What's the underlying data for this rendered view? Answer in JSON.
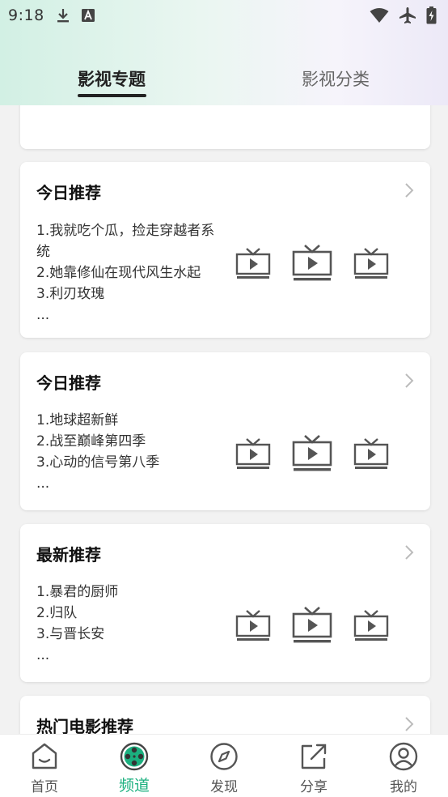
{
  "status": {
    "time": "9:18"
  },
  "tabs": [
    {
      "label": "影视专题",
      "active": true
    },
    {
      "label": "影视分类",
      "active": false
    }
  ],
  "cards": [
    {
      "title": "今日推荐",
      "lines": [
        "1.我就吃个瓜，捡走穿越者系统",
        "2.她靠修仙在现代风生水起",
        "3.利刃玫瑰",
        "..."
      ]
    },
    {
      "title": "今日推荐",
      "lines": [
        "1.地球超新鲜",
        "2.战至巅峰第四季",
        "3.心动的信号第八季",
        "..."
      ]
    },
    {
      "title": "最新推荐",
      "lines": [
        "1.暴君的厨师",
        "2.归队",
        "3.与晋长安",
        "..."
      ]
    },
    {
      "title": "热门电影推荐",
      "lines": []
    }
  ],
  "bottom_nav": [
    {
      "label": "首页",
      "icon": "home-face-icon",
      "active": false
    },
    {
      "label": "频道",
      "icon": "film-reel-icon",
      "active": true
    },
    {
      "label": "发现",
      "icon": "compass-icon",
      "active": false
    },
    {
      "label": "分享",
      "icon": "share-icon",
      "active": false
    },
    {
      "label": "我的",
      "icon": "user-icon",
      "active": false
    }
  ],
  "colors": {
    "accent": "#1bb07f",
    "icon_gray": "#555555"
  }
}
